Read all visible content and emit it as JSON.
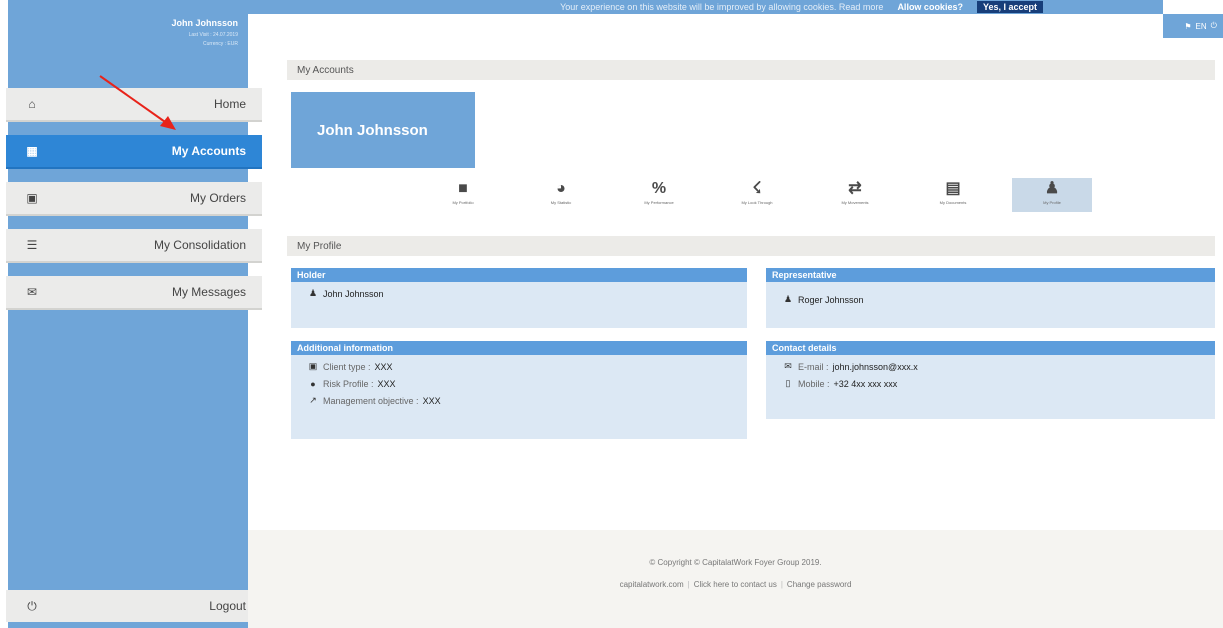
{
  "user": {
    "name": "John Johnsson",
    "last_visit": "Last Visit : 24.07.2019",
    "currency": "Currency : EUR"
  },
  "cookie_bar": {
    "message": "Your experience on this website will be improved by allowing cookies. Read more",
    "allow_label": "Allow cookies?",
    "accept_label": "Yes, I accept"
  },
  "language": "EN",
  "nav": {
    "home": "Home",
    "my_accounts": "My Accounts",
    "my_orders": "My Orders",
    "my_consolidation": "My Consolidation",
    "my_messages": "My Messages",
    "logout": "Logout"
  },
  "main": {
    "section_title": "My Accounts",
    "client_card_name": "John Johnsson",
    "profile_section_title": "My Profile"
  },
  "tiles": [
    {
      "label": "My Portfolio",
      "icon": "briefcase-icon"
    },
    {
      "label": "My Statistic",
      "icon": "pie-chart-icon"
    },
    {
      "label": "My Performance",
      "icon": "percent-icon"
    },
    {
      "label": "My Look Through",
      "icon": "sitemap-icon"
    },
    {
      "label": "My Movements",
      "icon": "exchange-icon"
    },
    {
      "label": "My Documents",
      "icon": "document-icon"
    },
    {
      "label": "My Profile",
      "icon": "user-icon"
    }
  ],
  "panels": {
    "holder": {
      "title": "Holder",
      "name": "John Johnsson"
    },
    "representative": {
      "title": "Representative",
      "name": "Roger Johnsson"
    },
    "additional": {
      "title": "Additional information",
      "client_type_label": "Client type :",
      "client_type_value": "XXX",
      "risk_profile_label": "Risk Profile :",
      "risk_profile_value": "XXX",
      "management_objective_label": "Management objective :",
      "management_objective_value": "XXX"
    },
    "contact": {
      "title": "Contact details",
      "email_label": "E-mail :",
      "email_value": "john.johnsson@xxx.x",
      "mobile_label": "Mobile :",
      "mobile_value": "+32 4xx xxx xxx"
    }
  },
  "footer": {
    "copyright": "© Copyright © CapitalatWork Foyer Group 2019.",
    "link_site": "capitalatwork.com",
    "link_contact": "Click here to contact us",
    "link_password": "Change password"
  },
  "colors": {
    "sidebar": "#6fa5d8",
    "active_nav": "#2e86d6",
    "panel_header": "#5d9ddc",
    "panel_body": "#dce8f4",
    "annotation_arrow": "#e8231a"
  }
}
